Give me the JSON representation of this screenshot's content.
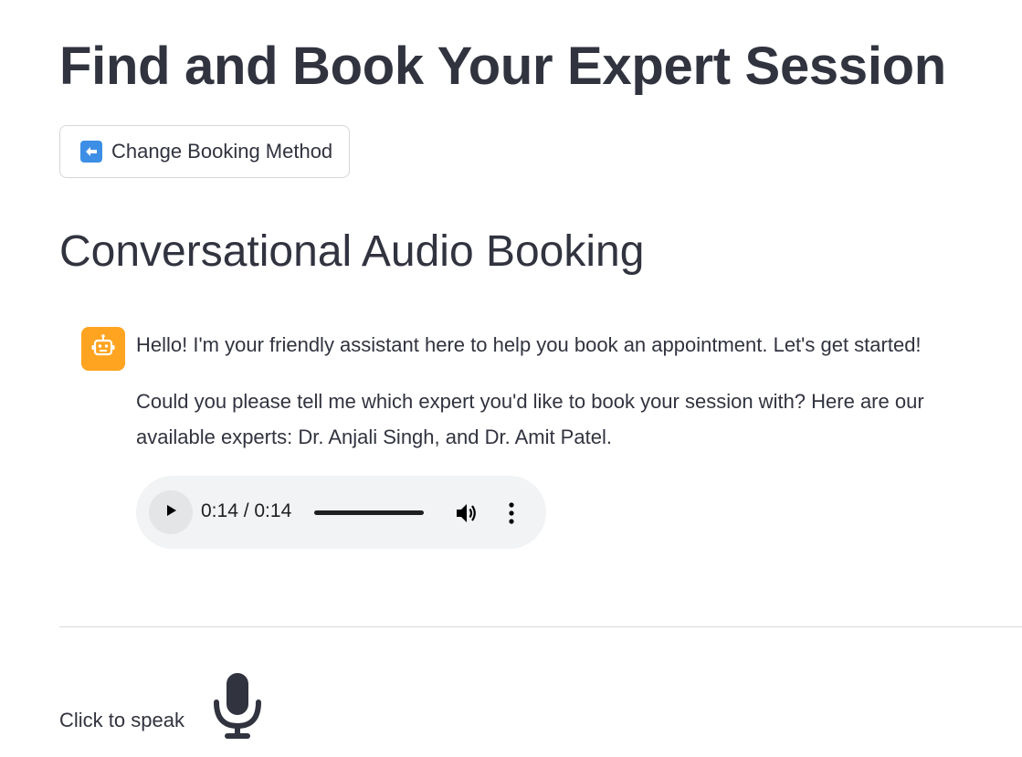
{
  "page": {
    "title": "Find and Book Your Expert Session"
  },
  "toolbar": {
    "change_method_label": "Change Booking Method",
    "change_method_icon": "left-arrow-emoji-icon"
  },
  "section": {
    "title": "Conversational Audio Booking"
  },
  "chat": {
    "assistant_avatar_icon": "robot-icon",
    "assistant_avatar_color": "#ffa421",
    "messages": [
      "Hello! I'm your friendly assistant here to help you book an appointment. Let's get started!",
      "Could you please tell me which expert you'd like to book your session with? Here are our available experts: Dr. Anjali Singh, and Dr. Amit Patel."
    ]
  },
  "audio": {
    "time_display": "0:14 / 0:14",
    "progress": 1.0
  },
  "speak": {
    "label": "Click to speak",
    "icon": "microphone-icon"
  },
  "colors": {
    "text": "#31333f",
    "accent_arrow": "#3d8fe6",
    "avatar": "#ffa421",
    "audio_bg": "#f1f3f4"
  }
}
